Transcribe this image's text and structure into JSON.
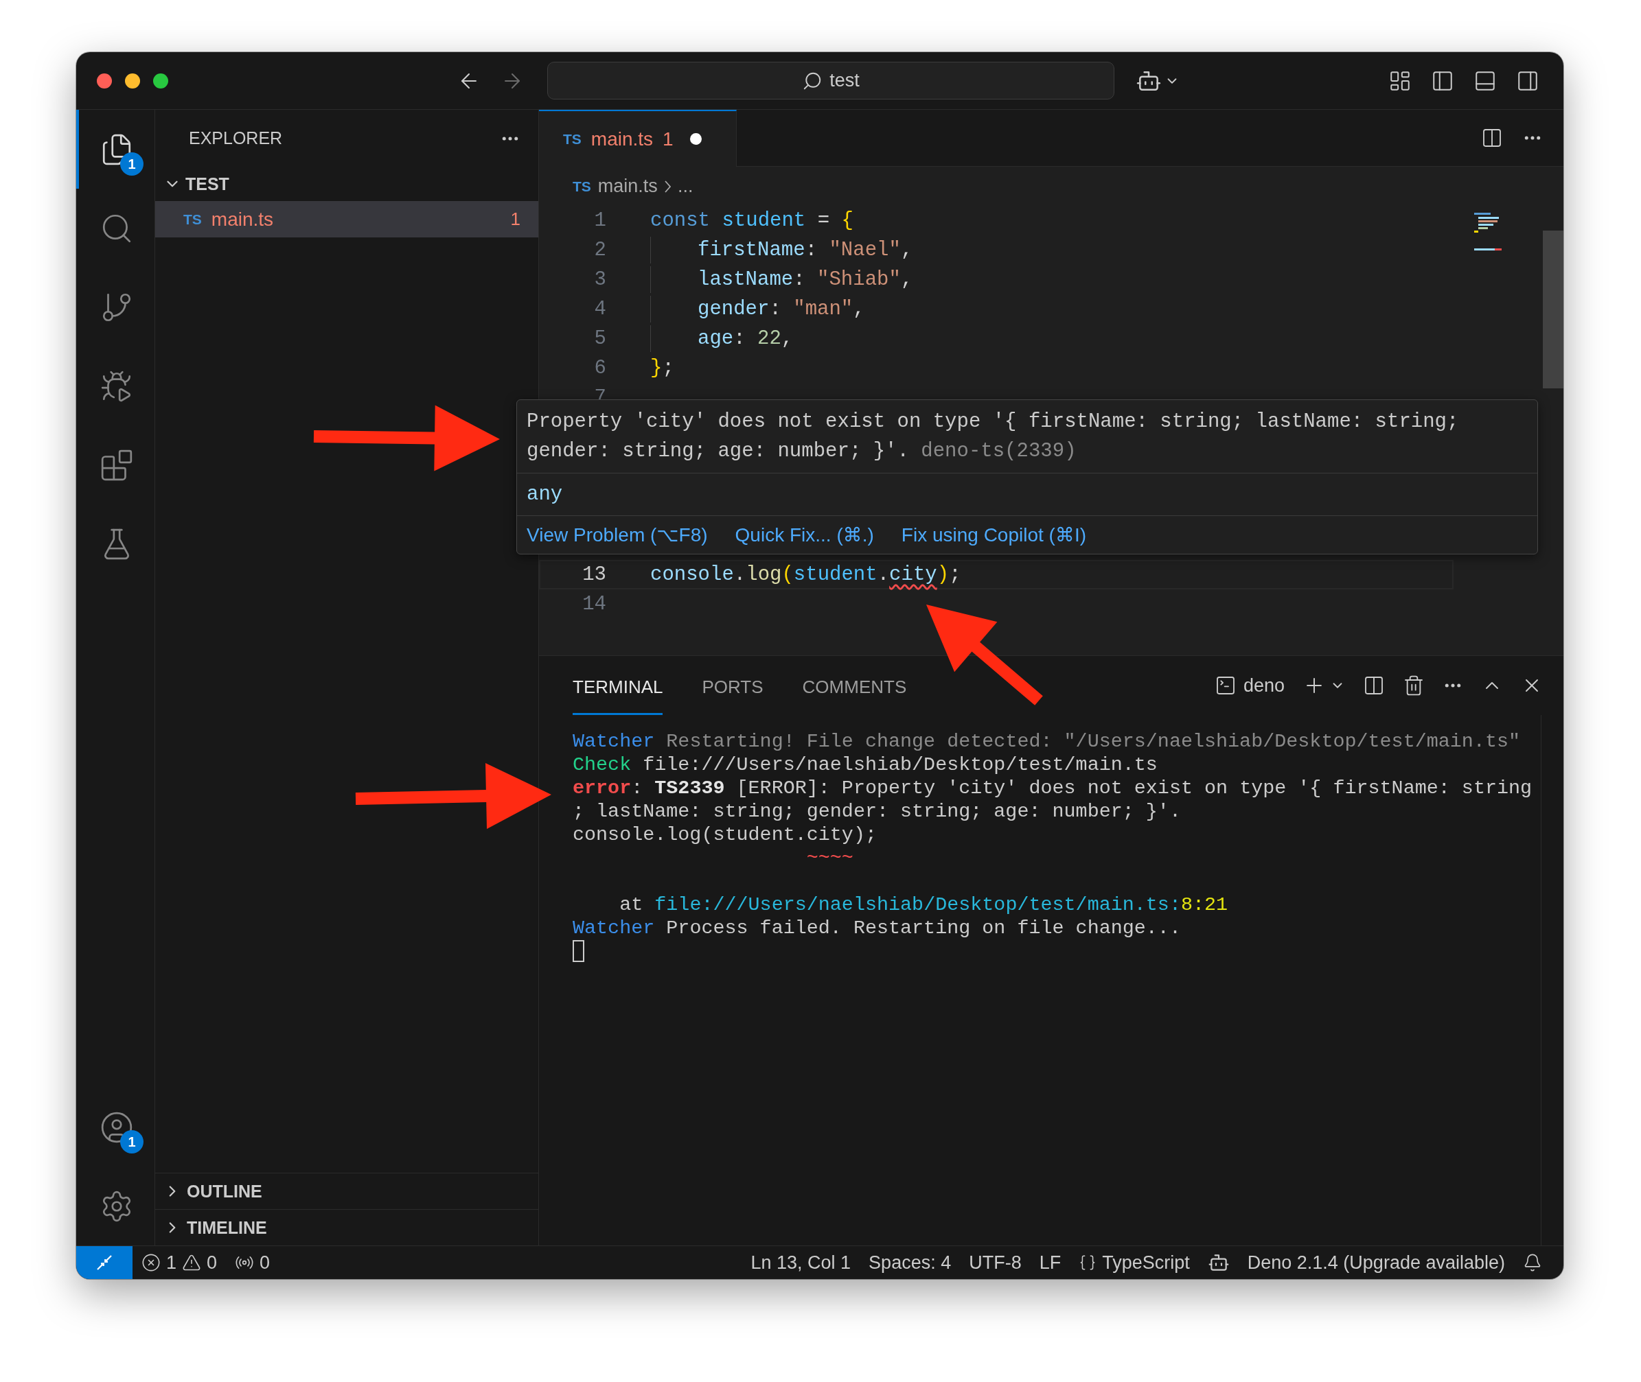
{
  "titlebar": {
    "search": {
      "value": "test"
    }
  },
  "activity_bar": {
    "top": [
      {
        "kind": "explorer",
        "selected": true,
        "badge": "1"
      },
      {
        "kind": "search",
        "selected": false
      },
      {
        "kind": "source-control",
        "selected": false
      },
      {
        "kind": "run",
        "selected": false
      },
      {
        "kind": "extensions",
        "selected": false
      },
      {
        "kind": "testing",
        "selected": false
      }
    ],
    "bottom": [
      {
        "kind": "accounts",
        "badge": "1"
      },
      {
        "kind": "settings"
      }
    ]
  },
  "sidebar": {
    "title": "EXPLORER",
    "folder": {
      "label": "TEST",
      "expanded": true,
      "files": [
        {
          "icon": "TS",
          "label": "main.ts",
          "problems": "1",
          "selected": true
        }
      ]
    },
    "sections": [
      {
        "label": "OUTLINE",
        "expanded": false
      },
      {
        "label": "TIMELINE",
        "expanded": false
      }
    ]
  },
  "editor": {
    "tabs": [
      {
        "icon": "TS",
        "label": "main.ts",
        "problems": "1",
        "modified": true,
        "selected": true
      }
    ],
    "breadcrumb": {
      "icon": "TS",
      "file": "main.ts",
      "more": "..."
    },
    "lines_above": [
      {
        "number": "1",
        "kind": "code",
        "current": false,
        "tokens": [
          {
            "kind": "keyword",
            "text": "const"
          },
          {
            "kind": "variable",
            "text": " student"
          },
          {
            "kind": "plain",
            "text": " ="
          },
          {
            "kind": "bracket",
            "text": " {"
          }
        ]
      },
      {
        "number": "2",
        "kind": "member",
        "current": false,
        "tokens": [
          {
            "kind": "property",
            "text": "firstName"
          },
          {
            "kind": "plain",
            "text": ":"
          },
          {
            "kind": "string",
            "text": " \"Nael\""
          },
          {
            "kind": "plain",
            "text": ","
          }
        ]
      },
      {
        "number": "3",
        "kind": "member",
        "current": false,
        "tokens": [
          {
            "kind": "property",
            "text": "lastName"
          },
          {
            "kind": "plain",
            "text": ":"
          },
          {
            "kind": "string",
            "text": " \"Shiab\""
          },
          {
            "kind": "plain",
            "text": ","
          }
        ]
      },
      {
        "number": "4",
        "kind": "member",
        "current": false,
        "tokens": [
          {
            "kind": "property",
            "text": "gender"
          },
          {
            "kind": "plain",
            "text": ":"
          },
          {
            "kind": "string",
            "text": " \"man\""
          },
          {
            "kind": "plain",
            "text": ","
          }
        ]
      },
      {
        "number": "5",
        "kind": "member",
        "current": false,
        "tokens": [
          {
            "kind": "property",
            "text": "age"
          },
          {
            "kind": "plain",
            "text": ":"
          },
          {
            "kind": "number",
            "text": " 22"
          },
          {
            "kind": "plain",
            "text": ","
          }
        ]
      },
      {
        "number": "6",
        "kind": "code",
        "current": false,
        "tokens": [
          {
            "kind": "bracket",
            "text": "}"
          },
          {
            "kind": "plain",
            "text": ";"
          }
        ]
      },
      {
        "number": "7",
        "kind": "empty",
        "current": false
      }
    ],
    "lines_below": [
      {
        "number": "13",
        "kind": "code",
        "current": true,
        "tokens": [
          {
            "kind": "property",
            "text": "console"
          },
          {
            "kind": "plain",
            "text": "."
          },
          {
            "kind": "function",
            "text": "log"
          },
          {
            "kind": "bracket",
            "text": "("
          },
          {
            "kind": "variable",
            "text": "student"
          },
          {
            "kind": "plain",
            "text": "."
          },
          {
            "kind": "error",
            "text": "city"
          },
          {
            "kind": "bracket",
            "text": ")"
          },
          {
            "kind": "plain",
            "text": ";"
          }
        ]
      },
      {
        "number": "14",
        "kind": "empty",
        "current": false
      }
    ]
  },
  "hover": {
    "message": "Property 'city' does not exist on type '{ firstName: string; lastName: string; gender: string; age: number; }'.",
    "source": "deno-ts(2339)",
    "type": "any",
    "actions": [
      "View Problem (⌥F8)",
      "Quick Fix... (⌘.)",
      "Fix using Copilot (⌘I)"
    ]
  },
  "panel": {
    "tabs": [
      {
        "label": "TERMINAL",
        "selected": true
      },
      {
        "label": "PORTS",
        "selected": false
      },
      {
        "label": "COMMENTS",
        "selected": false
      }
    ],
    "terminal_name": "deno",
    "lines": [
      {
        "kind": "text",
        "tokens": [
          {
            "kind": "info",
            "text": "Watcher"
          },
          {
            "kind": "dim",
            "text": " Restarting! File change detected: \"/Users/naelshiab/Desktop/test/main.ts\""
          }
        ]
      },
      {
        "kind": "text",
        "tokens": [
          {
            "kind": "ok",
            "text": "Check"
          },
          {
            "kind": "plain",
            "text": " file:///Users/naelshiab/Desktop/test/main.ts"
          }
        ]
      },
      {
        "kind": "text",
        "tokens": [
          {
            "kind": "error",
            "text": "error"
          },
          {
            "kind": "plain",
            "text": ":"
          },
          {
            "kind": "strong",
            "text": " TS2339"
          },
          {
            "kind": "plain",
            "text": " [ERROR]: Property 'city' does not exist on type '{ firstName: string"
          }
        ]
      },
      {
        "kind": "text",
        "tokens": [
          {
            "kind": "plain",
            "text": "; lastName: string; gender: string; age: number; }'."
          }
        ]
      },
      {
        "kind": "text",
        "tokens": [
          {
            "kind": "plain",
            "text": "console.log(student.city);"
          }
        ]
      },
      {
        "kind": "text",
        "tokens": [
          {
            "kind": "squiggle",
            "text": "                    ~~~~"
          }
        ]
      },
      {
        "kind": "blank"
      },
      {
        "kind": "text",
        "tokens": [
          {
            "kind": "plain",
            "text": "    at"
          },
          {
            "kind": "link",
            "text": " file:///Users/naelshiab/Desktop/test/main.ts"
          },
          {
            "kind": "link",
            "text": ":"
          },
          {
            "kind": "num",
            "text": "8"
          },
          {
            "kind": "num",
            "text": ":"
          },
          {
            "kind": "num",
            "text": "21"
          }
        ]
      },
      {
        "kind": "text",
        "tokens": [
          {
            "kind": "info",
            "text": "Watcher"
          },
          {
            "kind": "plain",
            "text": " Process failed. Restarting on file change..."
          }
        ]
      },
      {
        "kind": "cursor"
      }
    ]
  },
  "status_bar": {
    "errors": "1",
    "warnings": "0",
    "ports": "0",
    "items": [
      {
        "kind": "text",
        "label": "Ln 13, Col 1"
      },
      {
        "kind": "text",
        "label": "Spaces: 4"
      },
      {
        "kind": "text",
        "label": "UTF-8"
      },
      {
        "kind": "text",
        "label": "LF"
      },
      {
        "kind": "language",
        "label": "TypeScript"
      },
      {
        "kind": "copilot"
      },
      {
        "kind": "text",
        "label": "Deno 2.1.4 (Upgrade available)"
      },
      {
        "kind": "bell"
      }
    ]
  }
}
